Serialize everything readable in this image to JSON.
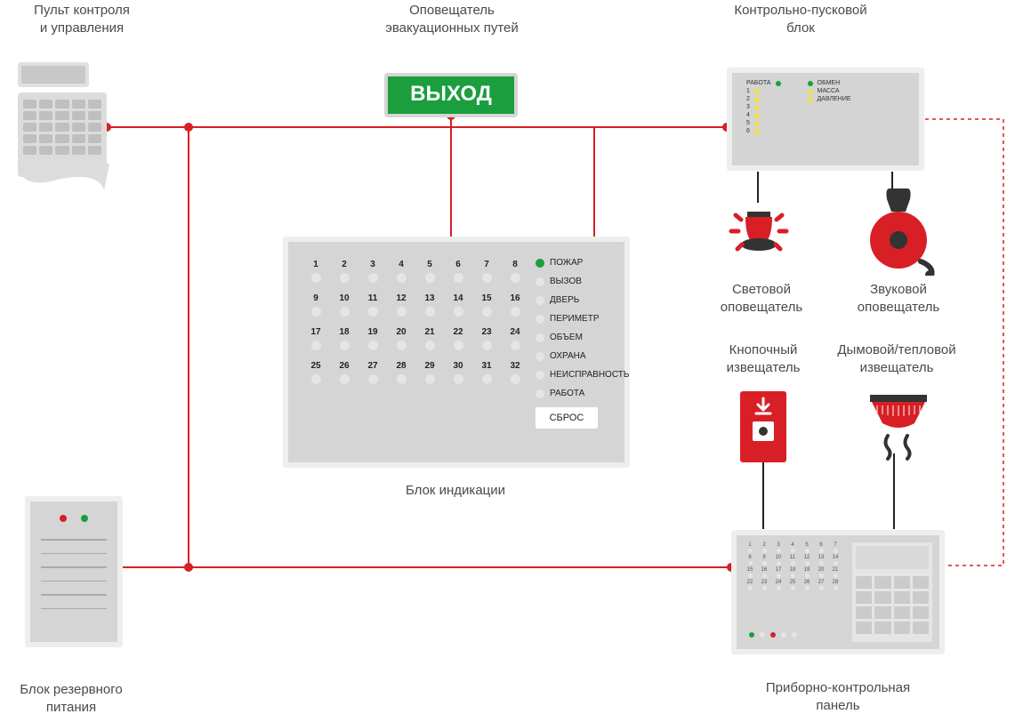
{
  "labels": {
    "control_keypad": "Пульт контроля\nи управления",
    "exit_announcer": "Оповещатель\nэвакуационных путей",
    "control_launch_block": "Контрольно-пусковой\nблок",
    "indication_block": "Блок индикации",
    "backup_power": "Блок резервного\nпитания",
    "light_announcer": "Световой\nоповещатель",
    "sound_announcer": "Звуковой\nоповещатель",
    "button_detector": "Кнопочный\nизвещатель",
    "smoke_heat_detector": "Дымовой/тепловой\nизвещатель",
    "control_panel": "Приборно-контрольная\nпанель"
  },
  "exit_sign_text": "ВЫХОД",
  "clblock": {
    "left": {
      "work": "РАБОТА",
      "nums": [
        "1",
        "2",
        "3",
        "4",
        "5",
        "6"
      ]
    },
    "right": {
      "exchange": "ОБМЕН",
      "mass": "МАССА",
      "pressure": "ДАВЛЕНИЕ"
    }
  },
  "indication": {
    "numbers": [
      [
        "1",
        "2",
        "3",
        "4",
        "5",
        "6",
        "7",
        "8"
      ],
      [
        "9",
        "10",
        "11",
        "12",
        "13",
        "14",
        "15",
        "16"
      ],
      [
        "17",
        "18",
        "19",
        "20",
        "21",
        "22",
        "23",
        "24"
      ],
      [
        "25",
        "26",
        "27",
        "28",
        "29",
        "30",
        "31",
        "32"
      ]
    ],
    "status_items": [
      "ПОЖАР",
      "ВЫЗОВ",
      "ДВЕРЬ",
      "ПЕРИМЕТР",
      "ОБЪЕМ",
      "ОХРАНА",
      "НЕИСПРАВНОСТЬ",
      "РАБОТА"
    ],
    "reset": "СБРОС"
  }
}
